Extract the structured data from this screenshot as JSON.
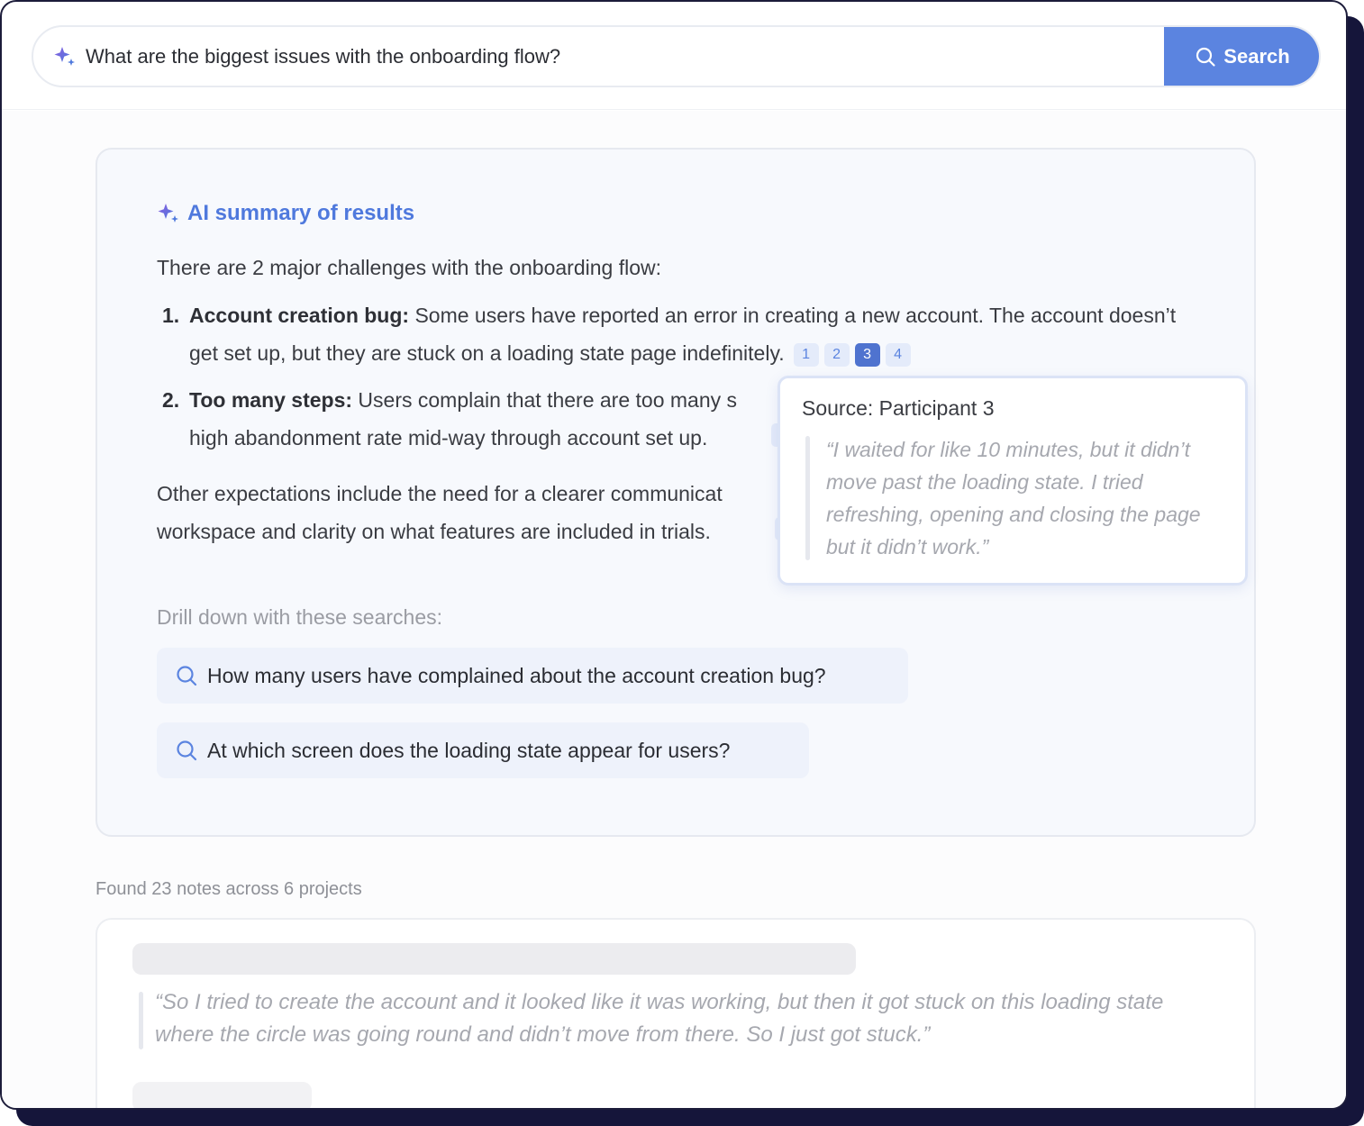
{
  "search": {
    "query": "What are the biggest issues with the onboarding flow?",
    "button_label": "Search",
    "accent_color": "#5b84e0"
  },
  "summary": {
    "title": "AI summary of results",
    "intro": "There are 2 major challenges with the onboarding flow:",
    "items": [
      {
        "number": "1.",
        "heading": "Account creation bug:",
        "text": " Some users have reported an error in creating a new account. The account doesn’t get set up, but they are stuck on a loading state page indefinitely.",
        "citations": [
          "1",
          "2",
          "3",
          "4"
        ],
        "active_citation": "3"
      },
      {
        "number": "2.",
        "heading": "Too many steps:",
        "text_line1": " Users complain that there are too many s",
        "text_line2": "high abandonment rate mid-way through account set up."
      }
    ],
    "other_line1": "Other expectations include the need for a clearer communicat",
    "other_line2": "workspace and clarity on what features are included in trials.",
    "drill_label": "Drill down with these searches:",
    "drill_searches": [
      "How many users have complained about the account creation bug?",
      "At which screen does the loading state appear for users?"
    ]
  },
  "popover": {
    "source": "Source: Participant 3",
    "quote": "“I waited for like 10 minutes, but it didn’t move past the loading state. I tried refreshing, opening and closing the page but it didn’t work.”"
  },
  "results": {
    "found_text": "Found 23 notes across 6 projects",
    "note_quote": "“So I tried to create the account and it looked like it was working, but then it got stuck on this loading state where the circle was going round and didn’t move from there. So I just got stuck.”"
  },
  "icons": {
    "query_icon": "sparkle-icon",
    "button_icon": "search-icon",
    "summary_icon": "sparkle-icon",
    "drill_icon": "search-icon"
  }
}
